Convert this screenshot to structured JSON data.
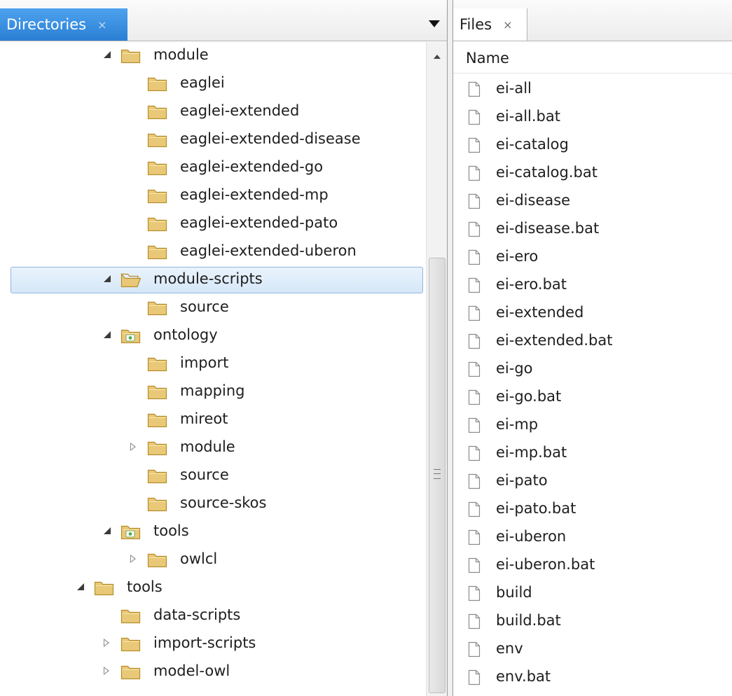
{
  "colors": {
    "active_tab": "#2f86da",
    "selection": "#dce9f7",
    "folder": "#e9c978",
    "project_badge": "#4caf50"
  },
  "directories_panel": {
    "tab_label": "Directories",
    "tab_close": "×",
    "tree": [
      {
        "label": "module",
        "depth": 2,
        "expander": "expanded",
        "icon": "folder-icon"
      },
      {
        "label": "eaglei",
        "depth": 3,
        "expander": "none",
        "icon": "folder-icon"
      },
      {
        "label": "eaglei-extended",
        "depth": 3,
        "expander": "none",
        "icon": "folder-icon"
      },
      {
        "label": "eaglei-extended-disease",
        "depth": 3,
        "expander": "none",
        "icon": "folder-icon"
      },
      {
        "label": "eaglei-extended-go",
        "depth": 3,
        "expander": "none",
        "icon": "folder-icon"
      },
      {
        "label": "eaglei-extended-mp",
        "depth": 3,
        "expander": "none",
        "icon": "folder-icon"
      },
      {
        "label": "eaglei-extended-pato",
        "depth": 3,
        "expander": "none",
        "icon": "folder-icon"
      },
      {
        "label": "eaglei-extended-uberon",
        "depth": 3,
        "expander": "none",
        "icon": "folder-icon"
      },
      {
        "label": "module-scripts",
        "depth": 2,
        "expander": "expanded",
        "icon": "folder-open-icon",
        "selected": true
      },
      {
        "label": "source",
        "depth": 3,
        "expander": "none",
        "icon": "folder-icon"
      },
      {
        "label": "ontology",
        "depth": 2,
        "expander": "expanded",
        "icon": "project-folder-icon"
      },
      {
        "label": "import",
        "depth": 3,
        "expander": "none",
        "icon": "folder-icon"
      },
      {
        "label": "mapping",
        "depth": 3,
        "expander": "none",
        "icon": "folder-icon"
      },
      {
        "label": "mireot",
        "depth": 3,
        "expander": "none",
        "icon": "folder-icon"
      },
      {
        "label": "module",
        "depth": 3,
        "expander": "collapsed",
        "icon": "folder-icon"
      },
      {
        "label": "source",
        "depth": 3,
        "expander": "none",
        "icon": "folder-icon"
      },
      {
        "label": "source-skos",
        "depth": 3,
        "expander": "none",
        "icon": "folder-icon"
      },
      {
        "label": "tools",
        "depth": 2,
        "expander": "expanded",
        "icon": "project-folder-icon"
      },
      {
        "label": "owlcl",
        "depth": 3,
        "expander": "collapsed",
        "icon": "folder-icon"
      },
      {
        "label": "tools",
        "depth": 1,
        "expander": "expanded",
        "icon": "folder-icon"
      },
      {
        "label": "data-scripts",
        "depth": 2,
        "expander": "none",
        "icon": "folder-icon"
      },
      {
        "label": "import-scripts",
        "depth": 2,
        "expander": "collapsed",
        "icon": "folder-icon"
      },
      {
        "label": "model-owl",
        "depth": 2,
        "expander": "collapsed",
        "icon": "folder-icon"
      }
    ]
  },
  "files_panel": {
    "tab_label": "Files",
    "tab_close": "×",
    "column_header": "Name",
    "files": [
      "ei-all",
      "ei-all.bat",
      "ei-catalog",
      "ei-catalog.bat",
      "ei-disease",
      "ei-disease.bat",
      "ei-ero",
      "ei-ero.bat",
      "ei-extended",
      "ei-extended.bat",
      "ei-go",
      "ei-go.bat",
      "ei-mp",
      "ei-mp.bat",
      "ei-pato",
      "ei-pato.bat",
      "ei-uberon",
      "ei-uberon.bat",
      "build",
      "build.bat",
      "env",
      "env.bat"
    ]
  }
}
